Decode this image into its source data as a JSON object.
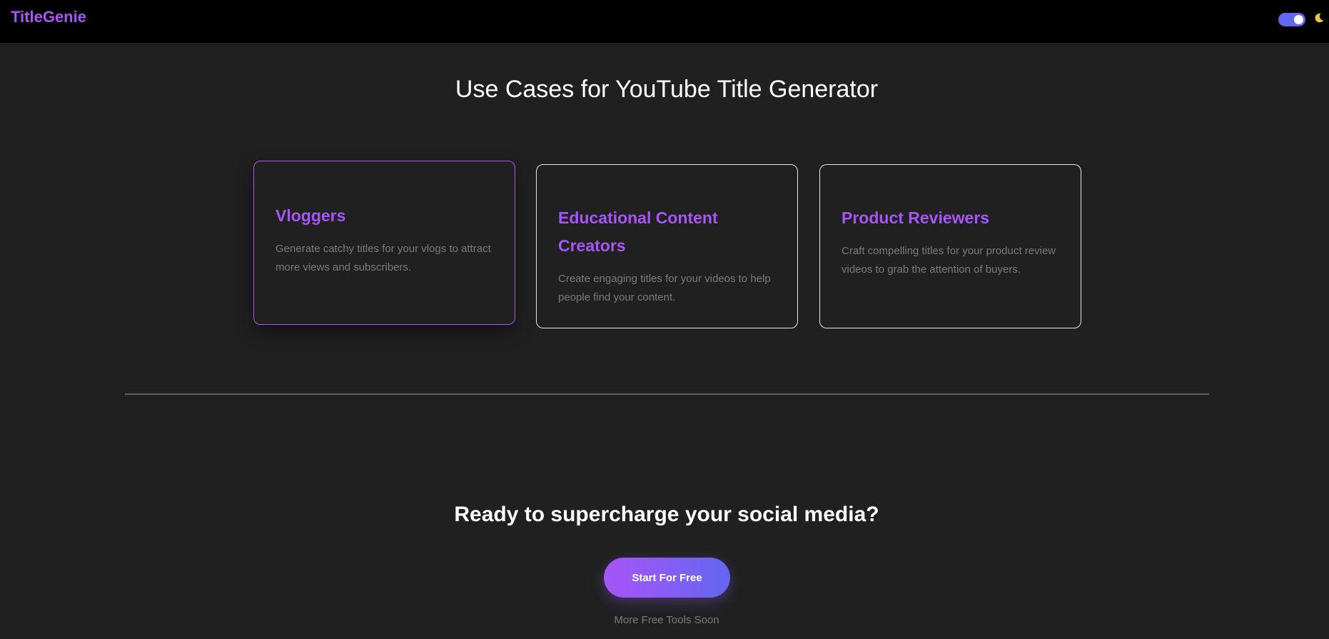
{
  "header": {
    "logo": "TitleGenie",
    "theme_toggle_on": true,
    "moon_icon": "moon-icon",
    "colors": {
      "brand": "#a855f7",
      "toggle": "#6366f1",
      "moon": "#f5c542"
    }
  },
  "use_cases": {
    "title": "Use Cases for YouTube Title Generator",
    "cards": [
      {
        "title": "Vloggers",
        "description": "Generate catchy titles for your vlogs to attract more views and subscribers."
      },
      {
        "title": "Educational Content Creators",
        "description": "Create engaging titles for your videos to help people find your content."
      },
      {
        "title": "Product Reviewers",
        "description": "Craft compelling titles for your product review videos to grab the attention of buyers."
      }
    ]
  },
  "cta": {
    "title": "Ready to supercharge your social media?",
    "button_label": "Start For Free",
    "footnote": "More Free Tools Soon"
  }
}
